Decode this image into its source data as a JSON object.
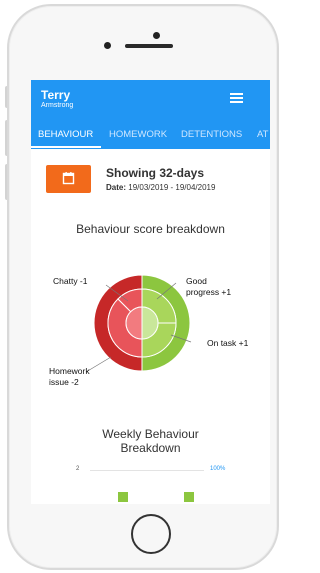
{
  "user": {
    "first_name": "Terry",
    "last_name": "Armstrong"
  },
  "tabs": [
    {
      "label": "BEHAVIOUR",
      "active": true
    },
    {
      "label": "HOMEWORK",
      "active": false
    },
    {
      "label": "DETENTIONS",
      "active": false
    },
    {
      "label": "AT",
      "active": false
    }
  ],
  "summary": {
    "showing": "Showing 32-days",
    "date_label": "Date:",
    "date_range": "19/03/2019 - 19/04/2019"
  },
  "behaviour_chart": {
    "title": "Behaviour score breakdown",
    "labels": {
      "chatty": "Chatty -1",
      "good_line1": "Good",
      "good_line2": "progress +1",
      "on_task": "On task +1",
      "homework_line1": "Homework",
      "homework_line2": "issue -2"
    },
    "colors": {
      "negative_outer": "#c62828",
      "negative_mid": "#e8545a",
      "negative_inner": "#f27b7f",
      "positive_outer": "#8cc63f",
      "positive_mid": "#a9d65b",
      "positive_inner": "#c9e79a"
    }
  },
  "weekly": {
    "title_line1": "Weekly Behaviour",
    "title_line2": "Breakdown",
    "axis_left": "2",
    "axis_right": "100%",
    "bar_color": "#8cc63f"
  },
  "theme": {
    "primary": "#2196f3",
    "accent": "#f26a1b"
  }
}
